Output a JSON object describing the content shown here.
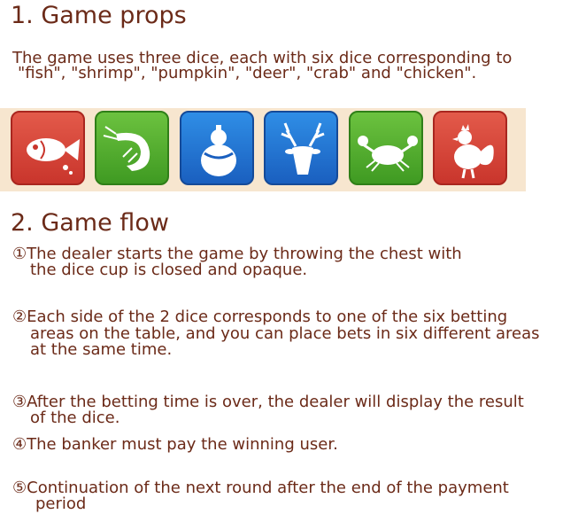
{
  "section1": {
    "heading": "1. Game props",
    "desc_line1": "The game uses three dice, each with six dice corresponding to",
    "desc_line2": "\"fish\", \"shrimp\", \"pumpkin\", \"deer\", \"crab\" and \"chicken\"."
  },
  "dice_icons": [
    {
      "icon": "fish-icon",
      "color": "#d9473c"
    },
    {
      "icon": "shrimp-icon",
      "color": "#4caf2c"
    },
    {
      "icon": "pumpkin-icon",
      "color": "#2479d6"
    },
    {
      "icon": "deer-icon",
      "color": "#2479d6"
    },
    {
      "icon": "crab-icon",
      "color": "#4caf2c"
    },
    {
      "icon": "chicken-icon",
      "color": "#d9473c"
    }
  ],
  "section2": {
    "heading": "2. Game flow",
    "steps": [
      {
        "line1": "①The dealer starts the game by throwing the chest with",
        "line2": "the dice cup is closed and opaque."
      },
      {
        "line1": "②Each side of the 2 dice corresponds to one of the six betting",
        "line2": "areas on the table, and you can place bets in six different areas",
        "line3": "at the same time."
      },
      {
        "line1": "③After the betting time is over, the dealer will display the result",
        "line2": "of the dice."
      },
      {
        "line1": "④The banker must pay the winning user."
      },
      {
        "line1": "⑤Continuation of the next round after the end of the payment",
        "line2": "period"
      }
    ]
  }
}
